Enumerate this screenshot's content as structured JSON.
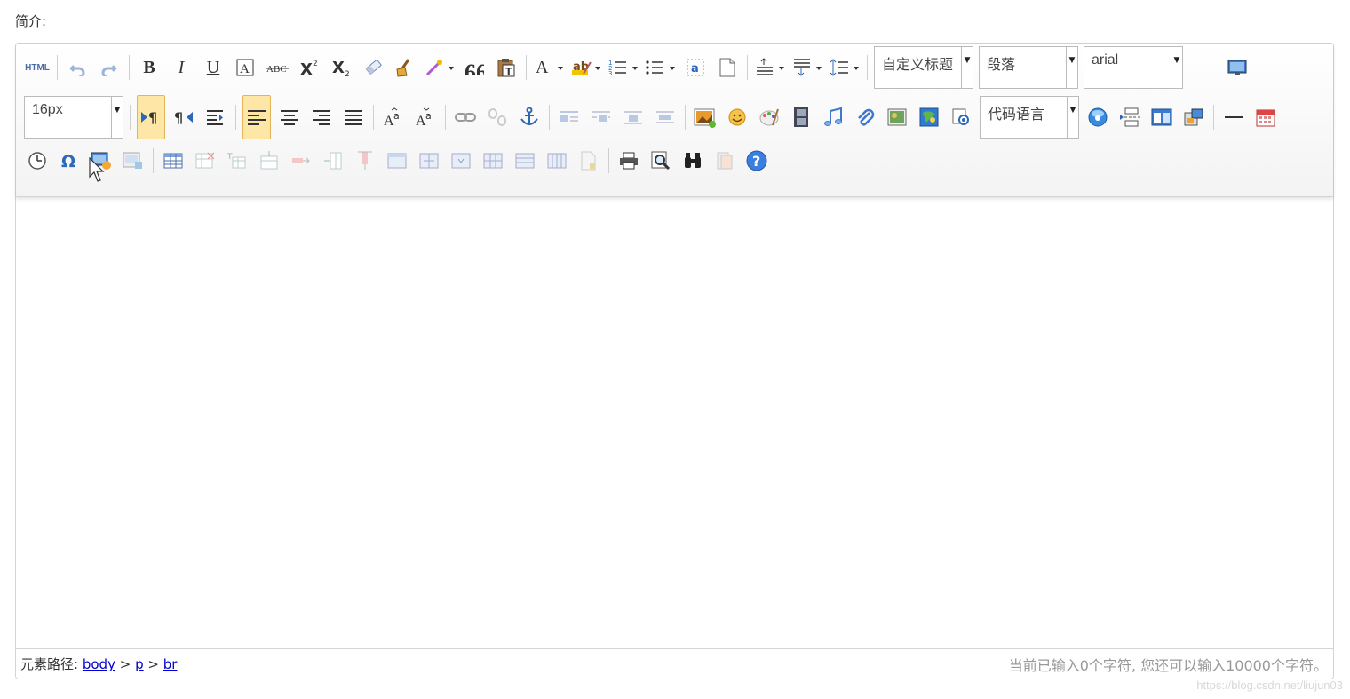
{
  "field_label": "简介:",
  "toolbar": {
    "html_label": "HTML",
    "bold": "B",
    "italic": "I",
    "underline": "U",
    "fontcolor": "A",
    "customstyle": "自定义标题",
    "paragraph": "段落",
    "fontfamily": "arial",
    "fontsize": "16px",
    "codelang": "代码语言"
  },
  "statusbar": {
    "path_label": "元素路径:",
    "path": [
      "body",
      "p",
      "br"
    ],
    "path_sep": ">",
    "word_count": "当前已输入0个字符, 您还可以输入10000个字符。"
  },
  "watermark": "https://blog.csdn.net/liujun03"
}
